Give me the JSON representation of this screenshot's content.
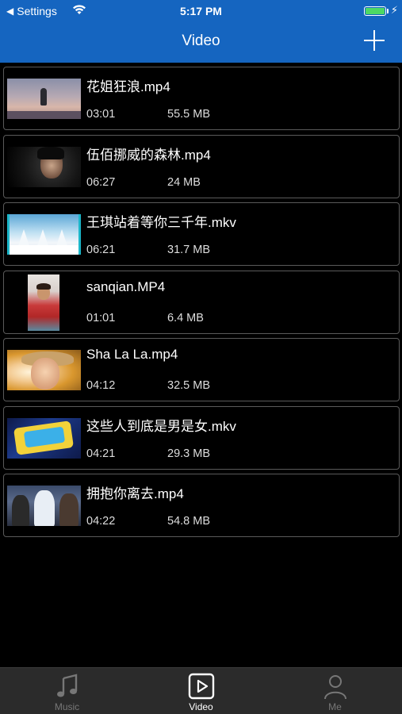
{
  "status_bar": {
    "back_label": "Settings",
    "time": "5:17 PM"
  },
  "nav": {
    "title": "Video"
  },
  "videos": [
    {
      "title": "花姐狂浪.mp4",
      "duration": "03:01",
      "size": "55.5 MB"
    },
    {
      "title": "伍佰挪威的森林.mp4",
      "duration": "06:27",
      "size": "24 MB"
    },
    {
      "title": "王琪站着等你三千年.mkv",
      "duration": "06:21",
      "size": "31.7 MB"
    },
    {
      "title": "sanqian.MP4",
      "duration": "01:01",
      "size": "6.4 MB"
    },
    {
      "title": "Sha La La.mp4",
      "duration": "04:12",
      "size": "32.5 MB"
    },
    {
      "title": "这些人到底是男是女.mkv",
      "duration": "04:21",
      "size": "29.3 MB"
    },
    {
      "title": "拥抱你离去.mp4",
      "duration": "04:22",
      "size": "54.8 MB"
    }
  ],
  "tabs": [
    {
      "label": "Music",
      "icon": "music-note-icon",
      "active": false
    },
    {
      "label": "Video",
      "icon": "play-square-icon",
      "active": true
    },
    {
      "label": "Me",
      "icon": "person-icon",
      "active": false
    }
  ],
  "colors": {
    "header": "#1565C0",
    "background": "#000000",
    "tabbar": "#2b2b2b",
    "battery": "#4cd964"
  }
}
